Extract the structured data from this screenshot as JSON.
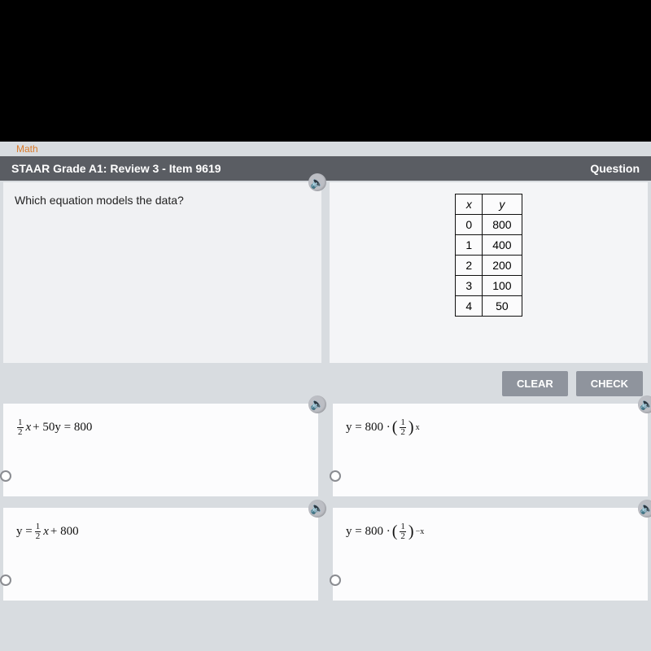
{
  "subject": "Math",
  "header": {
    "title": "STAAR Grade A1: Review 3 - Item 9619",
    "right_label": "Question"
  },
  "question": {
    "text": "Which equation models the data?"
  },
  "table": {
    "headers": {
      "x": "x",
      "y": "y"
    },
    "rows": [
      {
        "x": "0",
        "y": "800"
      },
      {
        "x": "1",
        "y": "400"
      },
      {
        "x": "2",
        "y": "200"
      },
      {
        "x": "3",
        "y": "100"
      },
      {
        "x": "4",
        "y": "50"
      }
    ]
  },
  "buttons": {
    "clear": "CLEAR",
    "check": "CHECK"
  },
  "answers": {
    "a": {
      "frac_n": "1",
      "frac_d": "2",
      "x": "x",
      "plus": " + 50y = 800"
    },
    "b": {
      "lhs": "y = 800 · ",
      "paren_open": "(",
      "frac_n": "1",
      "frac_d": "2",
      "paren_close": ")",
      "exp": "x"
    },
    "c": {
      "lhs": "y = ",
      "frac_n": "1",
      "frac_d": "2",
      "x": "x",
      "tail": " + 800"
    },
    "d": {
      "lhs": "y = 800 · ",
      "paren_open": "(",
      "frac_n": "1",
      "frac_d": "2",
      "paren_close": ")",
      "exp": "−x"
    }
  },
  "icons": {
    "audio": "🔈"
  }
}
